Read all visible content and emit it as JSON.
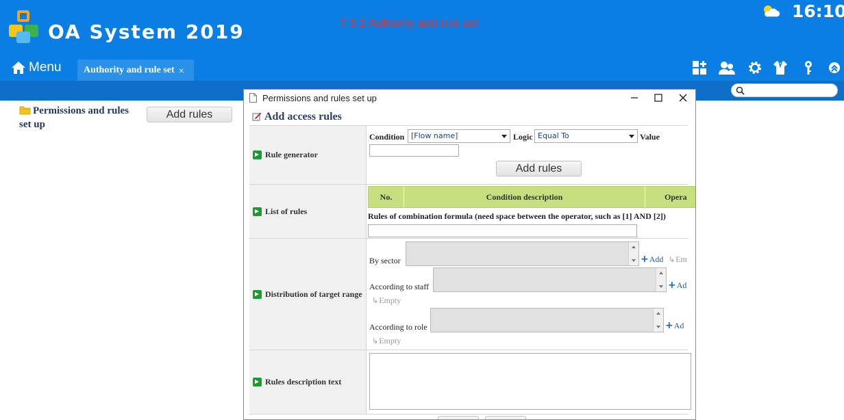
{
  "app": {
    "title": "OA System 2019",
    "document_title": "7.3.2 Authority and rule set",
    "clock": "16:10",
    "weather_icon": "partly-cloudy-icon",
    "header_color": "#0a7ee3"
  },
  "nav": {
    "menu_label": "Menu",
    "active_tab": "Authority and rule set",
    "tab_close": "×",
    "toolbar_icons": [
      "app-grid-icon",
      "users-icon",
      "settings-gear-icon",
      "shirt-icon",
      "key-icon",
      "collapse-up-icon"
    ]
  },
  "search": {
    "placeholder": ""
  },
  "left_panel": {
    "tree_label": "Permissions and rules set up",
    "add_button": "Add rules"
  },
  "dialog": {
    "title": "Permissions and rules set up",
    "heading": "Add access rules",
    "rule_generator": {
      "label": "Rule generator",
      "condition_label": "Condition",
      "condition_value": "[Flow name]",
      "logic_label": "Logic",
      "logic_value": "Equal To",
      "value_label": "Value",
      "value_input": "",
      "add_button": "Add rules"
    },
    "list_of_rules": {
      "label": "List of rules",
      "columns": [
        "No.",
        "Condition description",
        "Opera"
      ],
      "formula_label": "Rules of combination formula (need space between the operator, such as [1] AND [2])",
      "formula_value": ""
    },
    "distribution": {
      "label": "Distribution of target range",
      "by_sector": "By sector",
      "by_staff": "According to staff",
      "by_role": "According to role",
      "add_link": "Add",
      "add_link_cut": "Ad",
      "empty_link": "Empty",
      "empty_link_cut": "Em"
    },
    "description": {
      "label": "Rules description text",
      "text": ""
    }
  }
}
